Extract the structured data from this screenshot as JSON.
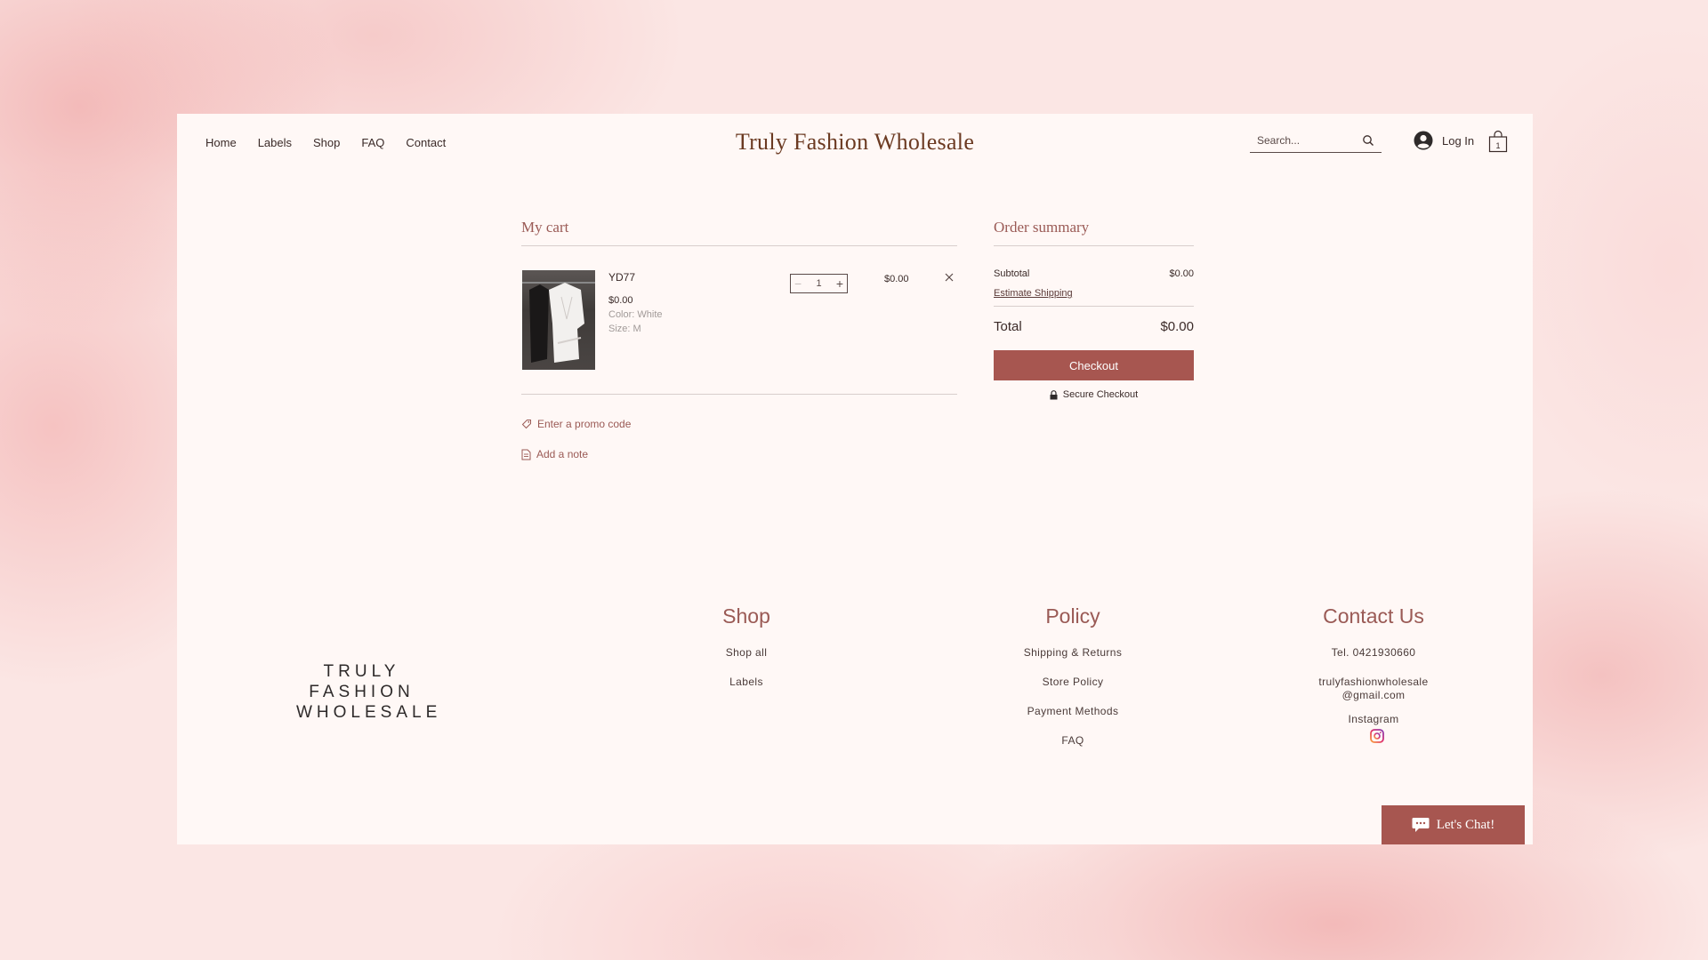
{
  "header": {
    "nav": [
      "Home",
      "Labels",
      "Shop",
      "FAQ",
      "Contact"
    ],
    "brand": "Truly Fashion Wholesale",
    "search_placeholder": "Search...",
    "login_label": "Log In",
    "cart_count": "1"
  },
  "cart": {
    "title": "My cart",
    "item": {
      "name": "YD77",
      "price": "$0.00",
      "color": "Color: White",
      "size": "Size: M",
      "quantity": "1",
      "line_total": "$0.00"
    },
    "promo_label": "Enter a promo code",
    "note_label": "Add a note"
  },
  "summary": {
    "title": "Order summary",
    "subtotal_label": "Subtotal",
    "subtotal_value": "$0.00",
    "shipping_label": "Estimate Shipping",
    "total_label": "Total",
    "total_value": "$0.00",
    "checkout_label": "Checkout",
    "secure_label": "Secure Checkout"
  },
  "footer": {
    "logo_lines": [
      "TRULY",
      "FASHION",
      "WHOLESALE"
    ],
    "shop": {
      "title": "Shop",
      "links": [
        "Shop all",
        "Labels"
      ]
    },
    "policy": {
      "title": "Policy",
      "links": [
        "Shipping & Returns",
        "Store Policy",
        "Payment Methods",
        "FAQ"
      ]
    },
    "contact": {
      "title": "Contact Us",
      "phone": "Tel. 0421930660",
      "email_line1": "trulyfashionwholesale",
      "email_line2": "@gmail.com",
      "instagram": "Instagram"
    }
  },
  "chat": {
    "label": "Let's Chat!"
  },
  "colors": {
    "accent": "#a75650",
    "brand_text": "#6b3a22",
    "heading": "#9a5a55"
  }
}
